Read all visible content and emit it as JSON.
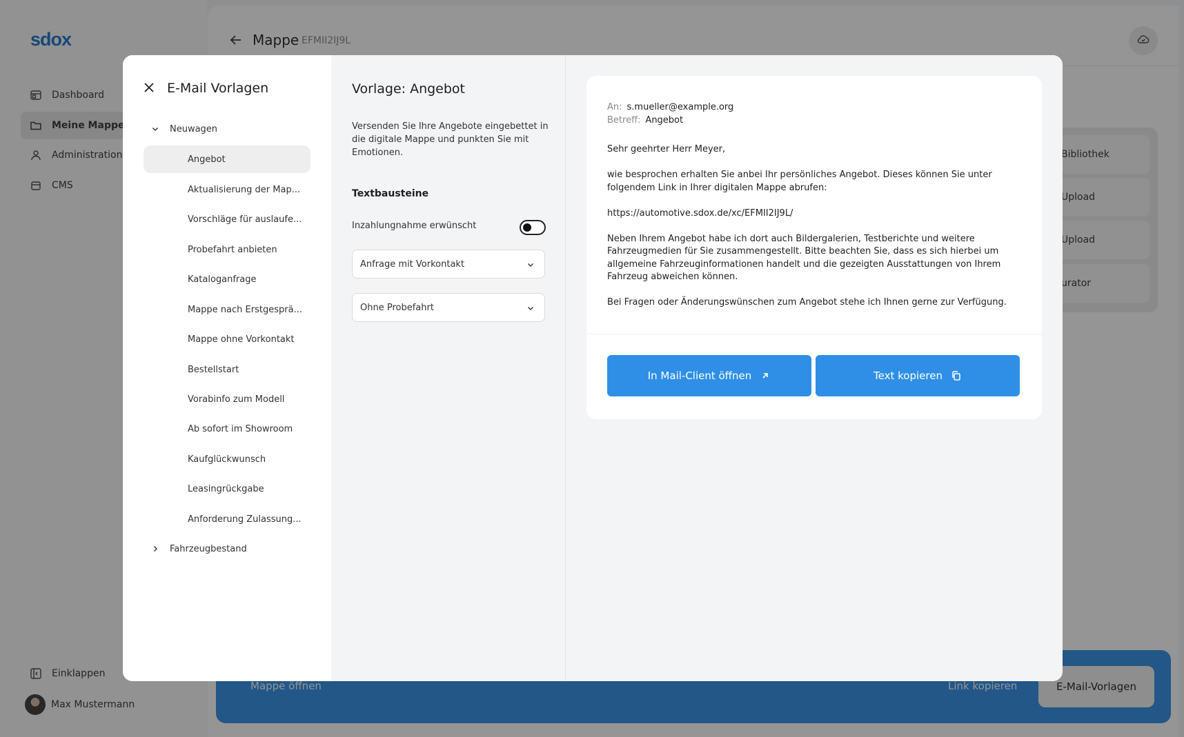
{
  "app": {
    "logo": "sdox",
    "nav": [
      {
        "label": "Dashboard",
        "icon": "dashboard-icon"
      },
      {
        "label": "Meine Mappen",
        "icon": "folder-icon",
        "active": true
      },
      {
        "label": "Administration",
        "icon": "user-icon"
      },
      {
        "label": "CMS",
        "icon": "database-icon"
      }
    ],
    "collapse_label": "Einklappen",
    "user_name": "Max Mustermann"
  },
  "header": {
    "title": "Mappe",
    "code": "EFMII2IJ9L"
  },
  "right_panel": {
    "items": [
      "Bibliothek",
      "Upload",
      "Upload",
      "urator"
    ]
  },
  "bottom_bar": {
    "open_label": "Mappe öffnen",
    "link_label": "Link kopieren",
    "email_label": "E-Mail-Vorlagen"
  },
  "modal": {
    "title": "E-Mail Vorlagen",
    "groups": [
      {
        "label": "Neuwagen",
        "expanded": true,
        "items": [
          "Angebot",
          "Aktualisierung der Map...",
          "Vorschläge für auslaufe...",
          "Probefahrt anbieten",
          "Kataloganfrage",
          "Mappe nach Erstgesprä...",
          "Mappe ohne Vorkontakt",
          "Bestellstart",
          "Vorabinfo zum Modell",
          "Ab sofort im Showroom",
          "Kaufglückwunsch",
          "Leasingrückgabe",
          "Anforderung Zulassung..."
        ]
      },
      {
        "label": "Fahrzeugbestand",
        "expanded": false,
        "items": []
      }
    ],
    "selected_template": "Angebot",
    "template": {
      "title": "Vorlage: Angebot",
      "description": "Versenden Sie Ihre Angebote eingebettet in die digitale Mappe und punkten Sie mit Emotionen.",
      "section_title": "Textbausteine",
      "toggle_label": "Inzahlungnahme erwünscht",
      "toggle_on": false,
      "select_1": "Anfrage mit Vorkontakt",
      "select_2": "Ohne Probefahrt"
    },
    "preview": {
      "to_label": "An:",
      "to_value": "s.mueller@example.org",
      "subject_label": "Betreff:",
      "subject_value": "Angebot",
      "body": "Sehr geehrter Herr Meyer,\n\nwie besprochen erhalten Sie anbei Ihr persönliches Angebot. Dieses können Sie unter folgendem Link in Ihrer digitalen Mappe abrufen:\n\nhttps://automotive.sdox.de/xc/EFMII2IJ9L/\n\nNeben Ihrem Angebot habe ich dort auch Bildergalerien, Testberichte und weitere Fahrzeugmedien für Sie zusammengestellt. Bitte beachten Sie, dass es sich hierbei um allgemeine Fahrzeuginformationen handelt und die gezeigten Ausstattungen von Ihrem Fahrzeug abweichen können.\n\nBei Fragen oder Änderungswünschen zum Angebot stehe ich Ihnen gerne zur Verfügung.",
      "btn_mail": "In Mail-Client öffnen",
      "btn_copy": "Text kopieren"
    }
  },
  "colors": {
    "accent": "#2f8fe6",
    "brand": "#1d73c9",
    "overlay": "#141414"
  }
}
